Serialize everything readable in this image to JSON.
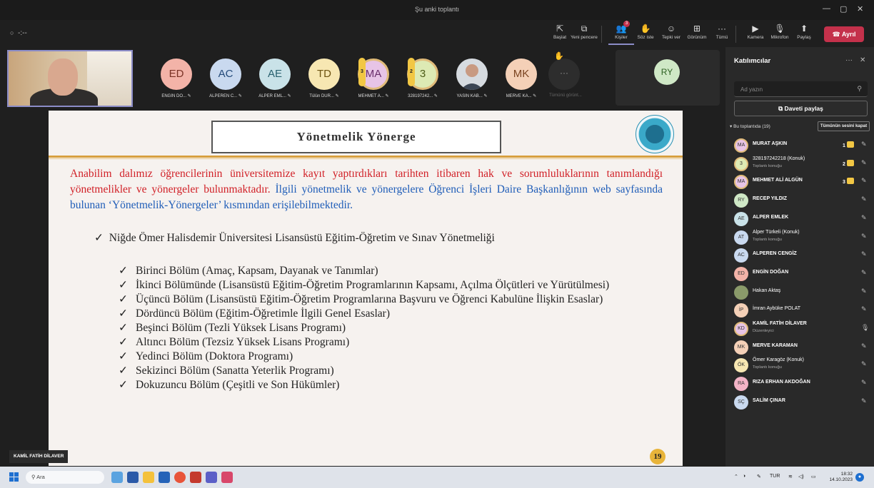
{
  "window": {
    "title": "Şu anki toplantı",
    "timer": "-:--"
  },
  "toolbar": {
    "buttons": [
      {
        "label": "Başlat",
        "icon": "⇱"
      },
      {
        "label": "Yeni pencere",
        "icon": "⧉"
      },
      {
        "label": "Kişiler",
        "icon": "👥",
        "badge": "3"
      },
      {
        "label": "Söz iste",
        "icon": "✋"
      },
      {
        "label": "Tepki ver",
        "icon": "☺"
      },
      {
        "label": "Görünüm",
        "icon": "⊞"
      },
      {
        "label": "Tümü",
        "icon": "···"
      },
      {
        "label": "Kamera",
        "icon": "▶"
      },
      {
        "label": "Mikrofon",
        "icon": "🎙"
      },
      {
        "label": "Paylaş",
        "icon": "⬆"
      }
    ],
    "leave_label": "Ayrıl",
    "leave_icon": "☎"
  },
  "strip": {
    "people": [
      {
        "initials": "ED",
        "name": "ENGİN DO...",
        "bg": "#f3b3a8",
        "fg": "#7a3225"
      },
      {
        "initials": "AC",
        "name": "ALPEREN C...",
        "bg": "#c9d9ef",
        "fg": "#244b7a"
      },
      {
        "initials": "AE",
        "name": "ALPER EML...",
        "bg": "#c9e2e8",
        "fg": "#2a6270"
      },
      {
        "initials": "TD",
        "name": "Tülün DUR...",
        "bg": "#f7e7b2",
        "fg": "#6e5412"
      },
      {
        "initials": "MA",
        "name": "MEHMET A...",
        "bg": "#e7c4e6",
        "fg": "#6a2f6c",
        "hand": "3"
      },
      {
        "initials": "3",
        "name": "328197242...",
        "bg": "#ddeab4",
        "fg": "#4d5c18",
        "hand": "2"
      },
      {
        "initials": "",
        "name": "YASİN KAB...",
        "bg": "#9aa3ad",
        "fg": "#333"
      },
      {
        "initials": "MK",
        "name": "MERVE KA...",
        "bg": "#f4d0b7",
        "fg": "#7a4320"
      }
    ],
    "more_label": "Tümünü görünt...",
    "featured_initials": "RY"
  },
  "slide": {
    "title": "Yönetmelik Yönerge",
    "para_red": "Anabilim dalımız öğrencilerinin üniversitemize kayıt yaptırdıkları tarihten itibaren hak ve sorumluluklarının tanımlandığı yönetmelikler ve yönergeler bulunmaktadır.",
    "para_blue": "İlgili yönetmelik ve yönergelere Öğrenci İşleri Daire Başkanlığının web sayfasında bulunan ‘Yönetmelik-Yönergeler’ kısmından erişilebilmektedir.",
    "main_item": "Niğde Ömer Halisdemir Üniversitesi Lisansüstü Eğitim-Öğretim ve Sınav Yönetmeliği",
    "sub_items": [
      "Birinci Bölüm (Amaç, Kapsam, Dayanak ve Tanımlar)",
      "İkinci Bölümünde (Lisansüstü Eğitim-Öğretim Programlarının Kapsamı, Açılma Ölçütleri ve Yürütülmesi)",
      "Üçüncü Bölüm (Lisansüstü Eğitim-Öğretim Programlarına Başvuru ve Öğrenci Kabulüne İlişkin Esaslar)",
      "Dördüncü Bölüm (Eğitim-Öğretimle İlgili Genel Esaslar)",
      "Beşinci Bölüm (Tezli Yüksek Lisans Programı)",
      "Altıncı Bölüm (Tezsiz Yüksek Lisans Programı)",
      "Yedinci Bölüm (Doktora Programı)",
      "Sekizinci Bölüm (Sanatta Yeterlik Programı)",
      "Dokuzuncu Bölüm (Çeşitli ve Son Hükümler)"
    ],
    "check": "✓",
    "page_number": "19"
  },
  "presenter_name": "KAMİL FATİH DİLAVER",
  "panel": {
    "title": "Katılımcılar",
    "search_placeholder": "Ad yazın",
    "share_label": "Daveti paylaş",
    "section_label": "Bu toplantıda (19)",
    "mute_all_label": "Tümünün sesini kapat",
    "participants": [
      {
        "initials": "MA",
        "name": "MURAT AŞKIN",
        "sub": "",
        "bg": "#e7c4e6",
        "hand": "1",
        "ring": true
      },
      {
        "initials": "3",
        "name": "328197242218 (Konuk)",
        "sub": "Toplantı konuğu",
        "bg": "#ddeab4",
        "hand": "2",
        "ring": true
      },
      {
        "initials": "MA",
        "name": "MEHMET ALİ ALGÜN",
        "sub": "",
        "bg": "#e7c4e6",
        "hand": "3",
        "ring": true
      },
      {
        "initials": "RY",
        "name": "RECEP YILDIZ",
        "sub": "",
        "bg": "#cfe8c6"
      },
      {
        "initials": "AE",
        "name": "ALPER EMLEK",
        "sub": "",
        "bg": "#c9e2e8"
      },
      {
        "initials": "AT",
        "name": "Alper Türkeli (Konuk)",
        "sub": "Toplantı konuğu",
        "bg": "#c9d9ef"
      },
      {
        "initials": "AC",
        "name": "ALPEREN CENGİZ",
        "sub": "",
        "bg": "#c9d9ef"
      },
      {
        "initials": "ED",
        "name": "ENGİN DOĞAN",
        "sub": "",
        "bg": "#f3b3a8"
      },
      {
        "initials": "",
        "name": "Hakan Aktaş",
        "sub": "",
        "bg": "#8a9a6a"
      },
      {
        "initials": "İP",
        "name": "İmran Aybüke POLAT",
        "sub": "",
        "bg": "#f4d0b7"
      },
      {
        "initials": "KD",
        "name": "KAMİL FATİH DİLAVER",
        "sub": "Düzenleyici",
        "bg": "#e7c4e6",
        "ring": true
      },
      {
        "initials": "MK",
        "name": "MERVE KARAMAN",
        "sub": "",
        "bg": "#f4d0b7"
      },
      {
        "initials": "ÖK",
        "name": "Ömer Karagöz (Konuk)",
        "sub": "Toplantı konuğu",
        "bg": "#f7e7b2"
      },
      {
        "initials": "RA",
        "name": "RIZA ERHAN AKDOĞAN",
        "sub": "",
        "bg": "#f3b3c6"
      },
      {
        "initials": "SÇ",
        "name": "SALİM ÇINAR",
        "sub": "",
        "bg": "#c9d9ef"
      }
    ]
  },
  "taskbar": {
    "search_label": "Ara",
    "language": "TUR",
    "time": "18:32",
    "date": "14.10.2023"
  }
}
